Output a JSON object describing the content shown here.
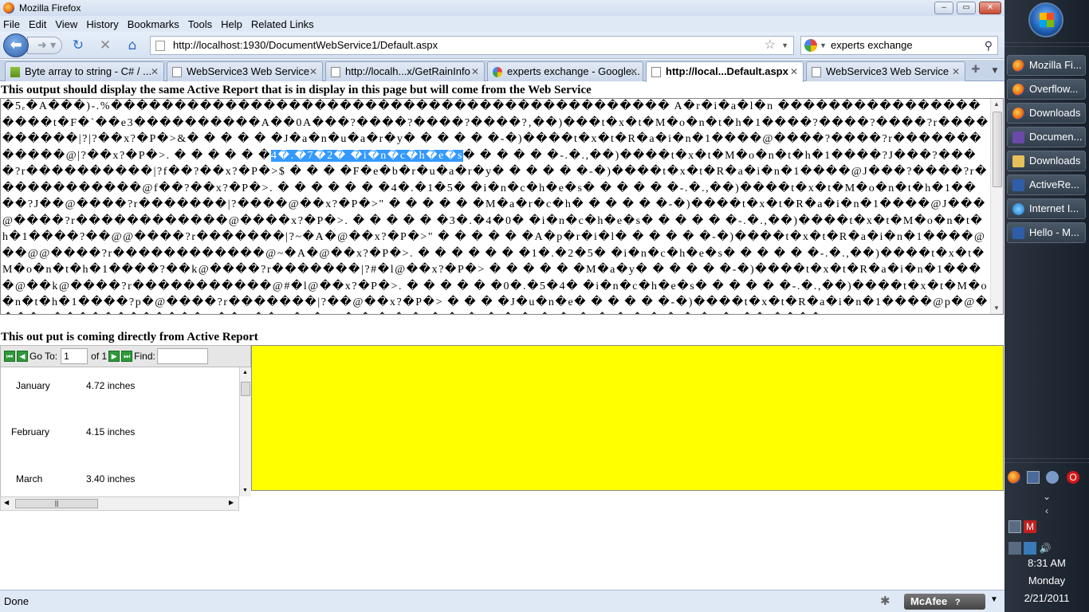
{
  "window": {
    "title": "Mozilla Firefox",
    "min": "‒",
    "max": "▭",
    "close": "✕"
  },
  "menu": [
    "File",
    "Edit",
    "View",
    "History",
    "Bookmarks",
    "Tools",
    "Help",
    "Related Links"
  ],
  "nav": {
    "url": "http://localhost:1930/DocumentWebService1/Default.aspx",
    "search": "experts exchange"
  },
  "tabs": [
    {
      "label": "Byte array to string - C# / ...",
      "icon": "stackoverflow-icon",
      "active": false
    },
    {
      "label": "WebService3 Web Service",
      "icon": "page-icon",
      "active": false
    },
    {
      "label": "http://localh...x/GetRainInfo",
      "icon": "page-icon",
      "active": false
    },
    {
      "label": "experts exchange - Google...",
      "icon": "google-icon",
      "active": false
    },
    {
      "label": "http://local...Default.aspx",
      "icon": "page-icon",
      "active": true
    },
    {
      "label": "WebService3 Web Service",
      "icon": "page-icon",
      "active": false
    }
  ],
  "page": {
    "heading1": "This output should display the same Active Report that is in display in this page but will come from the Web Service",
    "garbled_text": "�5ₑ�A���)-.%�������������������������������������������� A�r�i�a�l�n ��������������������t�F�`��e3����������A��0A���?����?����?����?‚��)���t�x�t�M�o�n�t�h�1����?����?����?r����������|?|?��x?�P�>&� � � � � �J�a�n�u�a�r�y� � � � � �-�)����t�x�t�R�a�i�n�1����@����?����?r������������@|?��x?�P�>. � � � � � �",
    "garbled_selected": "4�.�7�2� �i�n�c�h�e�s",
    "garbled_text2": "� � � � � �-.�.,��)����t�x�t�M�o�n�t�h�1����?J���?����?r����������|?f��?��x?�P�>$ � � � �F�e�b�r�u�a�r�y� � � � � �-�)����t�x�t�R�a�i�n�1����@J���?����?r������������@f��?��x?�P�>. � � � � � � �4�.�1�5� �i�n�c�h�e�s� � � � � �-.�.,��)����t�x�t�M�o�n�t�h�1����?J��@����?r�������|?����@��x?�P�>\" � � � � � �M�a�r�c�h� � � � � �-�)����t�x�t�R�a�i�n�1����@J���@����?r������������@����x?�P�>. � � � � � �3�.�4�0� �i�n�c�h�e�s� � � � � �-.�.,��)����t�x�t�M�o�n�t�h�1����?��@@����?r�������|?~�A�@��x?�P�>\" � � � � � �A�p�r�i�l� � � � � �-�)����t�x�t�R�a�i�n�1����@��@@����?r������������@~�A�@��x?�P�>. � � � � � � �1�.�2�5� �i�n�c�h�e�s� � � � � �-.�.,��)����t�x�t�M�o�n�t�h�1����?��k@����?r�������|?#�l@��x?�P�> � � � � � �M�a�y� � � � � �-�)����t�x�t�R�a�i�n�1����@��k@����?r�����������@#�l@��x?�P�>. � � � � � �0�.�5�4� �i�n�c�h�e�s� � � � � �-.�.,��)����t�x�t�M�o�n�t�h�1����?p�@����?r�������|?��@��x?�P�> � � � �J�u�n�e� � � � � �-�)����t�x�t�R�a�i�n�1����@p�@����?r������������@��@��x?�P�>* � � � � �0�.�1�3� �i�n�c�h�e�s� � � � � �-.�.,��)����",
    "heading2": "This out put is coming directly from Active Report"
  },
  "viewer": {
    "goto_label": "Go To:",
    "goto_value": "1",
    "of_label": "of 1",
    "find_label": "Find:",
    "find_value": "",
    "rows": [
      {
        "month": "January",
        "value": "4.72 inches"
      },
      {
        "month": "February",
        "value": "4.15 inches"
      },
      {
        "month": "March",
        "value": "3.40 inches"
      }
    ]
  },
  "status": {
    "text": "Done",
    "mcafee": "McAfee"
  },
  "taskbar": {
    "buttons": [
      {
        "label": "Mozilla Fi...",
        "icon": "firefox-icon"
      },
      {
        "label": "Overflow...",
        "icon": "firefox-icon"
      },
      {
        "label": "Downloads",
        "icon": "firefox-icon"
      },
      {
        "label": "Documen...",
        "icon": "visual-studio-icon"
      },
      {
        "label": "Downloads",
        "icon": "folder-icon"
      },
      {
        "label": "ActiveRe...",
        "icon": "document-icon"
      },
      {
        "label": "Internet I...",
        "icon": "internet-explorer-icon"
      },
      {
        "label": "Hello - M...",
        "icon": "document-icon"
      }
    ],
    "time": "8:31 AM",
    "day": "Monday",
    "date": "2/21/2011"
  }
}
